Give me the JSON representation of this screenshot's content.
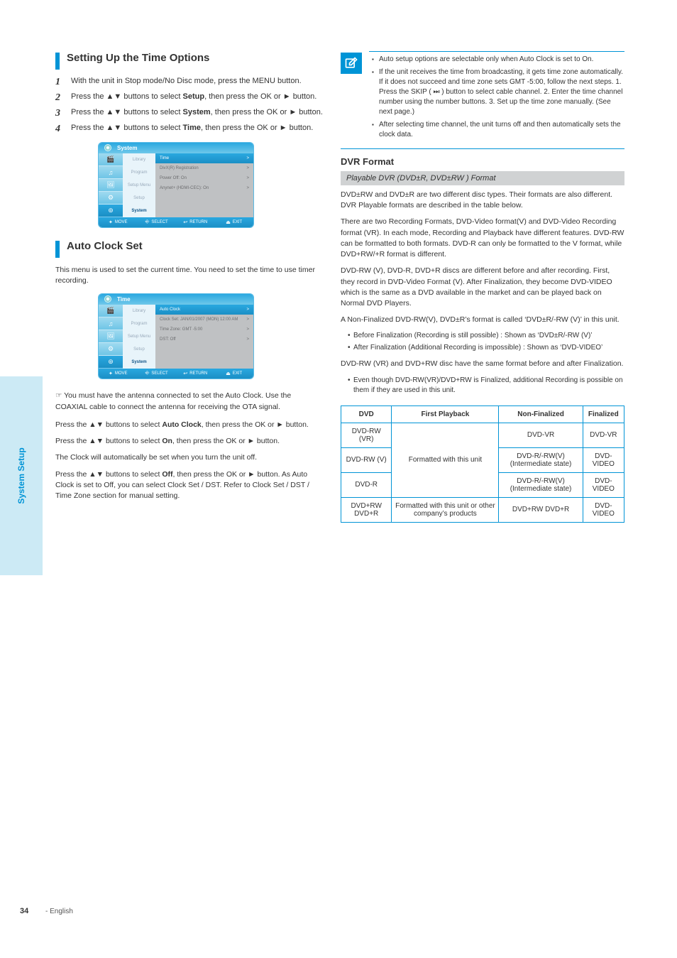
{
  "page": {
    "side_label": "System Setup",
    "number": "34",
    "footer": "- English"
  },
  "left": {
    "sect1": {
      "title": "Setting Up the Time Options",
      "step1_no": "1",
      "step1": "With the unit in Stop mode/No Disc mode, press the MENU button.",
      "step2_no": "2",
      "step2_pre": "Press the ▲▼ buttons to select ",
      "step2_menu": "Setup",
      "step2_post": ", then press the OK or ► button.",
      "step3_no": "3",
      "step3_pre": "Press the ▲▼ buttons to select ",
      "step3_menu": "System",
      "step3_post": ", then press the OK or ► button.",
      "step4_no": "4",
      "step4_pre": "Press the ▲▼ buttons to select ",
      "step4_menu": "Time",
      "step4_post": ", then press the OK or ► button."
    },
    "osd1": {
      "title": "System",
      "tabs": [
        "Library",
        "Program",
        "Setup Menu",
        "Setup",
        "System"
      ],
      "rows": [
        "Time",
        "DivX(R) Registration",
        "Power Off",
        "Anynet+ (HDMI-CEC)"
      ],
      "sel": 0,
      "arrows": [
        ">",
        ">",
        ">",
        ">"
      ],
      "pwr": ": On",
      "any": ": On",
      "footer": [
        [
          "✦",
          "MOVE"
        ],
        [
          "⎆",
          "SELECT"
        ],
        [
          "↩",
          "RETURN"
        ],
        [
          "⏏",
          "EXIT"
        ]
      ]
    },
    "sect2": {
      "title": "Auto Clock Set",
      "intro": "This menu is used to set the current time. You need to set the time to use timer recording.",
      "osd_title": "Time",
      "rows": [
        "Auto Clock",
        "Clock Set",
        "Time Zone",
        "DST"
      ],
      "sel_text": "Auto Clock",
      "clock": ": JAN/01/2007 (MON) 12:00 AM",
      "tz": ": GMT -5:00",
      "dst": ": Off",
      "sel": 0,
      "rest_intro_heading": "",
      "body1": "You must have the antenna connected to set the Auto Clock. Use the COAXIAL cable to connect the antenna for receiving the OTA signal.",
      "body2_pre": "Press the ▲▼ buttons to select ",
      "body2_menu": "Auto Clock",
      "body2_post": ", then press the OK or ► button.",
      "body3_pre": "Press the ▲▼ buttons to select ",
      "body3_opt": "On",
      "body3_post": ", then press the OK or ► button.",
      "body4": "The Clock will automatically be set when you turn the unit off.",
      "body5_pre": "Press the ▲▼ buttons to select ",
      "body5_opt": "Off",
      "body5_post": ", then press the OK or ► button. As Auto Clock is set to Off, you can select Clock Set / DST. Refer to Clock Set / DST / Time Zone section for manual setting."
    }
  },
  "right": {
    "note_items": [
      "Auto setup options are selectable only when Auto Clock is set to On.",
      "If the unit receives the time from broadcasting, it gets time zone automatically. If it does not succeed and time zone sets GMT -5:00, follow the next steps. 1. Press the SKIP ( ⏭ ) button to select cable channel. 2. Enter the time channel number using the number buttons. 3. Set up the time zone manually. (See next page.)",
      "After selecting time channel, the unit turns off and then automatically sets the clock data."
    ],
    "dvr_title": "DVR Format",
    "dvr_sub": "Playable DVR (DVD±R, DVD±RW ) Format",
    "p1": "DVD±RW and DVD±R are two different disc types. Their formats are also different. DVR Playable formats are described in the table below.",
    "p2": "There are two Recording Formats, DVD-Video format(V) and DVD-Video Recording format (VR). In each mode, Recording and Playback have different features. DVD-RW can be formatted to both formats. DVD-R can only be formatted to the V format, while DVD+RW/+R format is different.",
    "p3": "DVD-RW (V), DVD-R, DVD+R discs are different before and after recording. First, they record in DVD-Video Format (V). After Finalization, they become DVD-VIDEO which is the same as a DVD available in the market and can be played back on Normal DVD Players.",
    "bul_pre": "A Non-Finalized DVD-RW(V), DVD±R’s format is called ‘DVD±R/-RW (V)’ in this unit.",
    "ul": [
      "Before Finalization (Recording is still possible) : Shown as ‘DVD±R/-RW (V)’",
      "After Finalization (Additional Recording is impossible) : Shown as ‘DVD-VIDEO’"
    ],
    "p4": "DVD-RW (VR) and DVD+RW disc have the same format before and after Finalization.",
    "ul2": [
      "Even though DVD-RW(VR)/DVD+RW is Finalized, additional Recording is possible on them if they are used in this unit."
    ],
    "table": {
      "h1": "DVD",
      "h2": "First Playback",
      "h3": "Non-Finalized",
      "h4": "Finalized",
      "r1c1": "DVD-RW (VR)",
      "r1c2": "DVD-VR",
      "r1c3": "DVD-VR",
      "r2c1": "DVD-RW (V)",
      "r2c2rs": "Formatted with this unit",
      "r2c3": "DVD-R/-RW(V) (Intermediate state)",
      "r2c4": "DVD-VIDEO",
      "r3c1": "DVD-R",
      "r3c3": "DVD-R/-RW(V) (Intermediate state)",
      "r3c4": "DVD-VIDEO",
      "r4c1": "DVD+RW DVD+R",
      "r4c2": "Formatted with this unit or other company’s products",
      "r4c3": "DVD+RW DVD+R",
      "r4c4": "DVD-VIDEO"
    }
  }
}
